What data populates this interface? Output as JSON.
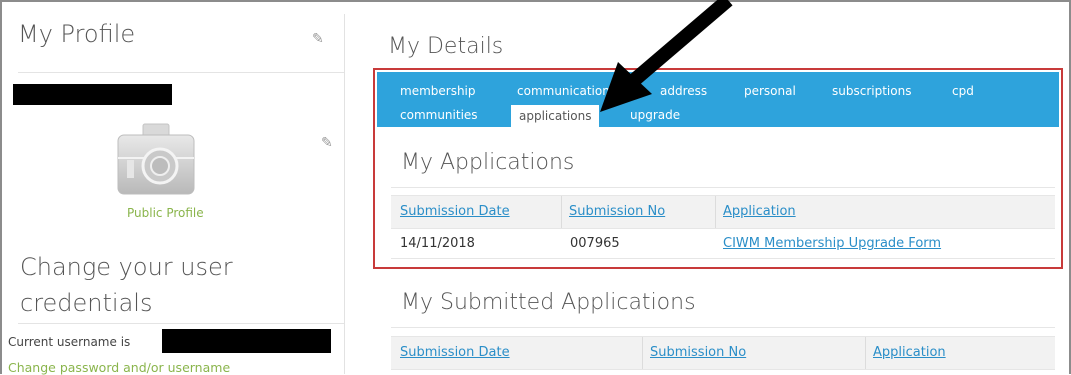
{
  "profile": {
    "title": "My Profile",
    "public_profile_label": "Public Profile",
    "credentials_title": "Change your user credentials",
    "current_username_label": "Current username is",
    "change_password_link": "Change password and/or username"
  },
  "details": {
    "title": "My Details",
    "tabs_row1": [
      "membership",
      "communications",
      "address",
      "personal",
      "subscriptions",
      "cpd"
    ],
    "tabs_row2": [
      "communities",
      "applications",
      "upgrade"
    ],
    "active_tab": "applications"
  },
  "applications": {
    "title": "My Applications",
    "columns": [
      "Submission Date",
      "Submission No",
      "Application"
    ],
    "rows": [
      [
        "14/11/2018",
        "007965",
        "CIWM Membership Upgrade Form"
      ]
    ]
  },
  "submitted": {
    "title": "My Submitted Applications",
    "columns": [
      "Submission Date",
      "Submission No",
      "Application"
    ]
  },
  "colors": {
    "tab_bar": "#2ea3dc",
    "highlight_border": "#c83a3a",
    "link": "#2a8ec8",
    "accent_green": "#8ab54c"
  }
}
